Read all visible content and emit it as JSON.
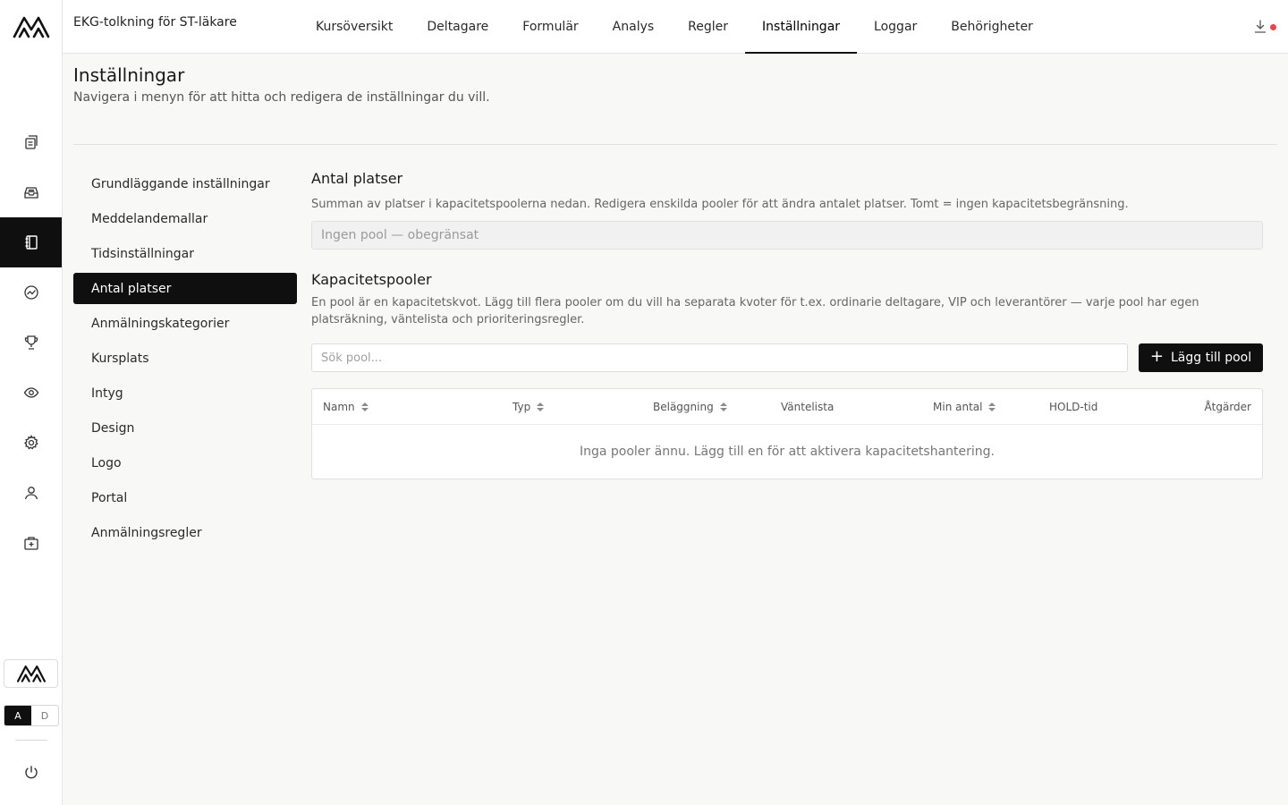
{
  "header": {
    "course_title": "EKG-tolkning för ST-läkare",
    "tabs": [
      {
        "label": "Kursöversikt"
      },
      {
        "label": "Deltagare"
      },
      {
        "label": "Formulär"
      },
      {
        "label": "Analys"
      },
      {
        "label": "Regler"
      },
      {
        "label": "Inställningar",
        "active": true
      },
      {
        "label": "Loggar"
      },
      {
        "label": "Behörigheter"
      }
    ],
    "download_icon": "download-icon",
    "notification_color": "#e5484d"
  },
  "rail": {
    "icons": [
      "documents-icon",
      "inbox-icon",
      "notebook-icon",
      "chart-icon",
      "trophy-icon",
      "eye-icon",
      "gear-icon",
      "user-icon",
      "medical-box-icon"
    ],
    "active_index": 2,
    "lang_on": "A",
    "lang_off": "D"
  },
  "page": {
    "title": "Inställningar",
    "subtitle": "Navigera i menyn för att hitta och redigera de inställningar du vill."
  },
  "menu": {
    "items": [
      "Grundläggande inställningar",
      "Meddelandemallar",
      "Tidsinställningar",
      "Antal platser",
      "Anmälningskategorier",
      "Kursplats",
      "Intyg",
      "Design",
      "Logo",
      "Portal",
      "Anmälningsregler"
    ],
    "active": "Antal platser"
  },
  "seats": {
    "title": "Antal platser",
    "description": "Summan av platser i kapacitetspoolerna nedan. Redigera enskilda pooler för att ändra antalet platser. Tomt = ingen kapacitetsbegränsning.",
    "value": "Ingen pool — obegränsat"
  },
  "pools": {
    "title": "Kapacitetspooler",
    "description": "En pool är en kapacitetskvot. Lägg till flera pooler om du vill ha separata kvoter för t.ex. ordinarie deltagare, VIP och leverantörer — varje pool har egen platsräkning, väntelista och prioriteringsregler.",
    "search_placeholder": "Sök pool...",
    "search_value": "",
    "add_label": "Lägg till pool",
    "columns": {
      "name": "Namn",
      "type": "Typ",
      "occupancy": "Beläggning",
      "waitlist": "Väntelista",
      "min": "Min antal",
      "hold": "HOLD-tid",
      "actions": "Åtgärder"
    },
    "empty": "Inga pooler ännu. Lägg till en för att aktivera kapacitetshantering."
  }
}
